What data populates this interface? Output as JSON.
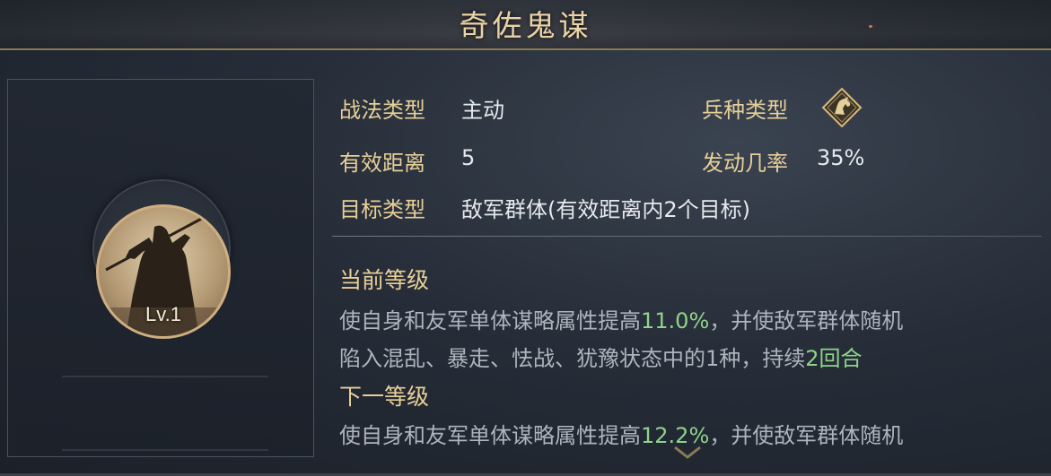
{
  "skill": {
    "name": "奇佐鬼谋",
    "level": "Lv.1"
  },
  "stats": {
    "type_label": "战法类型",
    "type_value": "主动",
    "troop_label": "兵种类型",
    "troop_icon": "horse-icon",
    "range_label": "有效距离",
    "range_value": "5",
    "rate_label": "发动几率",
    "rate_value": "35%",
    "target_label": "目标类型",
    "target_value": "敌军群体(有效距离内2个目标)"
  },
  "current": {
    "heading": "当前等级",
    "line1_pre": "使自身和友军单体谋略属性提高",
    "line1_value": "11.0%",
    "line1_post": "，并使敌军群体随机",
    "line2_pre": "陷入混乱、暴走、怯战、犹豫状态中的1种，持续",
    "line2_value": "2回合"
  },
  "next": {
    "heading": "下一等级",
    "line1_pre": "使自身和友军单体谋略属性提高",
    "line1_value": "12.2%",
    "line1_post": "，并使敌军群体随机"
  },
  "colors": {
    "label_gold": "#e7cf98",
    "value_white": "#e6e9ee",
    "desc_gray": "#aeb4bd",
    "highlight_green": "#8fd38a",
    "title_gold": "#ead3a7"
  }
}
